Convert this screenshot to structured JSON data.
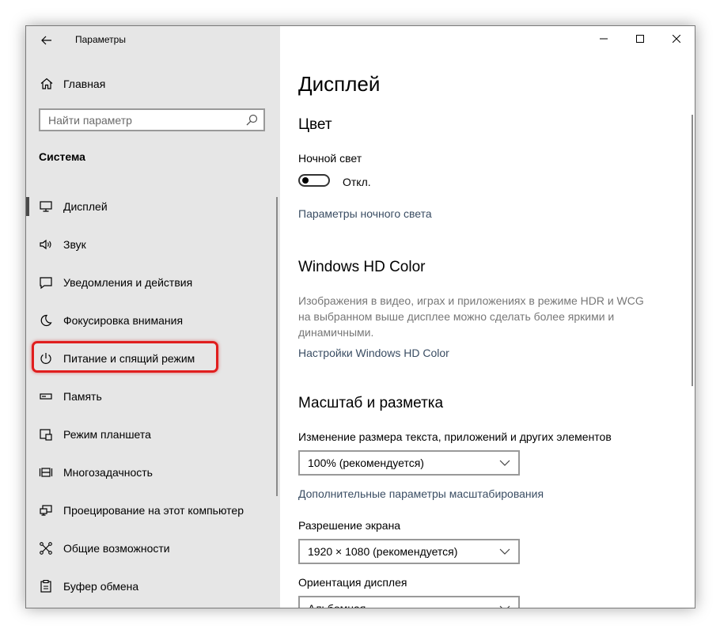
{
  "window": {
    "title": "Параметры",
    "controls": [
      "minimize-icon",
      "maximize-icon",
      "close-icon"
    ]
  },
  "sidebar": {
    "home_label": "Главная",
    "search_placeholder": "Найти параметр",
    "section_title": "Система",
    "items": [
      {
        "label": "Дисплей",
        "icon": "monitor-icon",
        "active": true
      },
      {
        "label": "Звук",
        "icon": "speaker-icon"
      },
      {
        "label": "Уведомления и действия",
        "icon": "notification-icon"
      },
      {
        "label": "Фокусировка внимания",
        "icon": "moon-icon"
      },
      {
        "label": "Питание и спящий режим",
        "icon": "power-icon",
        "highlighted": true
      },
      {
        "label": "Память",
        "icon": "storage-icon"
      },
      {
        "label": "Режим планшета",
        "icon": "tablet-icon"
      },
      {
        "label": "Многозадачность",
        "icon": "multitasking-icon"
      },
      {
        "label": "Проецирование на этот компьютер",
        "icon": "projecting-icon"
      },
      {
        "label": "Общие возможности",
        "icon": "shared-experiences-icon"
      },
      {
        "label": "Буфер обмена",
        "icon": "clipboard-icon"
      }
    ]
  },
  "main": {
    "title": "Дисплей",
    "color": {
      "heading": "Цвет",
      "night_light_label": "Ночной свет",
      "toggle_state": "Откл.",
      "night_light_link": "Параметры ночного света"
    },
    "hd_color": {
      "heading": "Windows HD Color",
      "description": "Изображения в видео, играх и приложениях в режиме HDR и WCG на выбранном выше дисплее можно сделать более яркими и динамичными.",
      "link": "Настройки Windows HD Color"
    },
    "scale": {
      "heading": "Масштаб и разметка",
      "size_label": "Изменение размера текста, приложений и других элементов",
      "size_value": "100% (рекомендуется)",
      "advanced_link": "Дополнительные параметры масштабирования",
      "resolution_label": "Разрешение экрана",
      "resolution_value": "1920 × 1080 (рекомендуется)",
      "orientation_label": "Ориентация дисплея",
      "orientation_value": "Альбомная"
    }
  },
  "colors": {
    "sidebar_bg": "#e6e6e6",
    "highlight_border": "#e01e1e",
    "link": "#3a4d63"
  }
}
